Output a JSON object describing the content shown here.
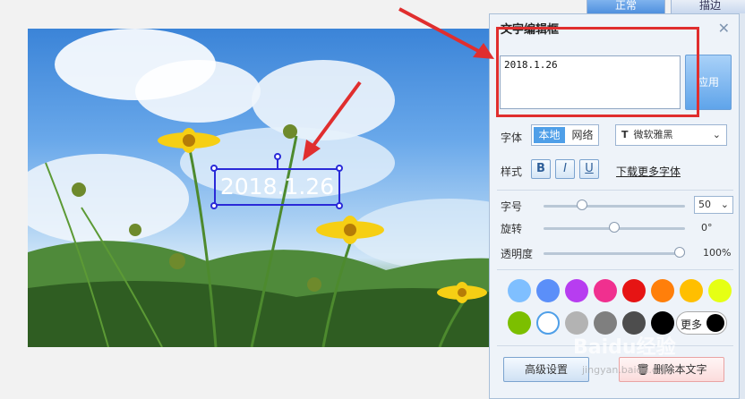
{
  "top_tabs": [
    {
      "label": "正常",
      "active": true
    },
    {
      "label": "描边",
      "active": false
    }
  ],
  "canvas": {
    "overlay_text": "2018.1.26"
  },
  "panel": {
    "title": "文字编辑框",
    "text_value": "2018.1.26",
    "apply_label": "应用",
    "font_row": {
      "label": "字体",
      "source_options": [
        "本地",
        "网络"
      ],
      "source_selected": "本地",
      "font_name": "微软雅黑"
    },
    "style_row": {
      "label": "样式",
      "bold": "B",
      "italic": "I",
      "underline": "U",
      "download_link": "下载更多字体"
    },
    "size_row": {
      "label": "字号",
      "value": "50",
      "slider_fraction": 0.25
    },
    "rotate_row": {
      "label": "旋转",
      "value": "0°",
      "slider_fraction": 0.5
    },
    "opacity_row": {
      "label": "透明度",
      "value": "100%",
      "slider_fraction": 1.0
    },
    "colors": [
      "#7fbfff",
      "#5b8ff9",
      "#b73df0",
      "#f0308f",
      "#e61414",
      "#ff7f0a",
      "#ffbf00",
      "#e6ff14",
      "#7cbf00",
      "#ffffff",
      "#b3b3b3",
      "#7f7f7f",
      "#4d4d4d",
      "#000000"
    ],
    "more_label": "更多",
    "advanced_label": "高级设置",
    "delete_label": "删除本文字"
  },
  "watermark": {
    "text": "Baidu经验",
    "sub": "jingyan.baidu.com"
  }
}
